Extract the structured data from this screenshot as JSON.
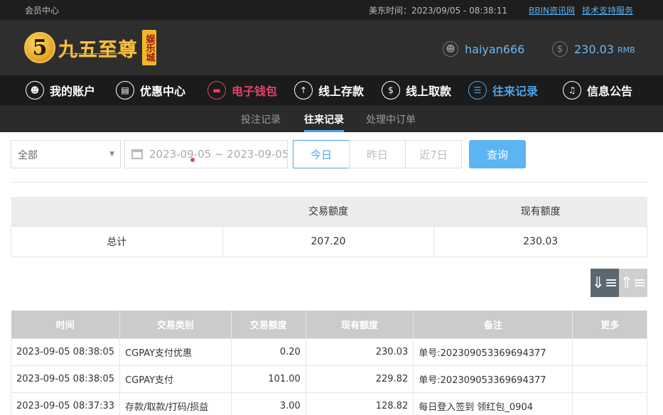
{
  "topbar": {
    "title": "会员中心",
    "time_label": "美东时间：2023/09/05 - 08:38:11",
    "link_news": "BBIN资讯网",
    "link_support": "技术支持服务"
  },
  "header": {
    "logo_mark": "5",
    "logo_text": "九五至尊",
    "logo_badge": "娱乐城",
    "username": "haiyan666",
    "balance": "230.03",
    "balance_unit": "RMB"
  },
  "mainnav": {
    "items": [
      {
        "label": "我的账户",
        "icon": "user-icon"
      },
      {
        "label": "优惠中心",
        "icon": "gift-icon"
      },
      {
        "label": "电子钱包",
        "icon": "wallet-icon"
      },
      {
        "label": "线上存款",
        "icon": "deposit-icon"
      },
      {
        "label": "线上取款",
        "icon": "withdraw-icon"
      },
      {
        "label": "往来记录",
        "icon": "records-icon"
      },
      {
        "label": "信息公告",
        "icon": "bell-icon"
      }
    ]
  },
  "subnav": {
    "items": [
      "投注记录",
      "往来记录",
      "处理中订单"
    ]
  },
  "filter": {
    "type_value": "全部",
    "date_range": "2023-09-05 ~ 2023-09-05",
    "quick_today": "今日",
    "quick_yesterday": "昨日",
    "quick_7days": "近7日",
    "search_label": "查询"
  },
  "summary": {
    "headers": [
      "",
      "交易额度",
      "现有额度"
    ],
    "row": [
      "总计",
      "207.20",
      "230.03"
    ]
  },
  "table": {
    "headers": [
      "时间",
      "交易类别",
      "交易额度",
      "现有额度",
      "备注",
      "更多"
    ],
    "rows": [
      [
        "2023-09-05 08:38:05",
        "CGPAY支付优惠",
        "0.20",
        "230.03",
        "单号:202309053369694377",
        ""
      ],
      [
        "2023-09-05 08:38:05",
        "CGPAY支付",
        "101.00",
        "229.82",
        "单号:202309053369694377",
        ""
      ],
      [
        "2023-09-05 08:37:33",
        "存款/取款/打码/损益",
        "3.00",
        "128.82",
        "每日登入签到 领红包_0904",
        ""
      ]
    ]
  },
  "colors": {
    "accent_blue": "#4ca4ec",
    "accent_pink": "#e8416b",
    "gold": "#f4c047"
  }
}
